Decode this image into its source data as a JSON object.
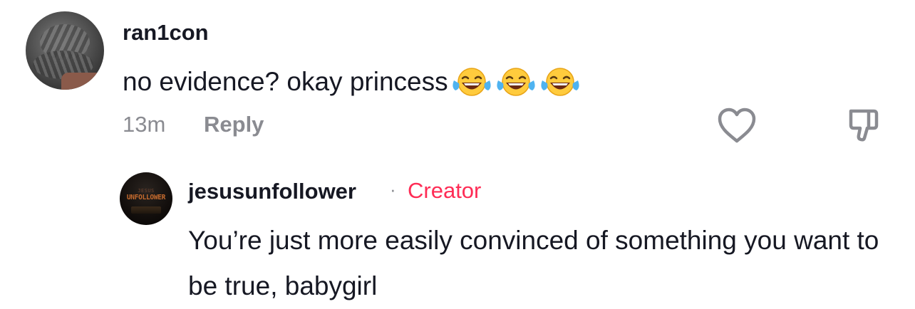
{
  "comment": {
    "username": "ran1con",
    "text": "no evidence? okay princess",
    "emojis": [
      "face-with-tears-of-joy-icon",
      "face-with-tears-of-joy-icon",
      "face-with-tears-of-joy-icon"
    ],
    "time": "13m",
    "reply_label": "Reply"
  },
  "reply": {
    "username": "jesusunfollower",
    "separator": "·",
    "badge": "Creator",
    "text": "You’re just more easily convinced of something you want to be true, babygirl",
    "avatar_top_text": "JESUS",
    "avatar_text": "UNFOLLOWER"
  },
  "colors": {
    "primary_text": "#161823",
    "secondary_text": "#8a8b91",
    "creator_accent": "#fe2c55"
  }
}
